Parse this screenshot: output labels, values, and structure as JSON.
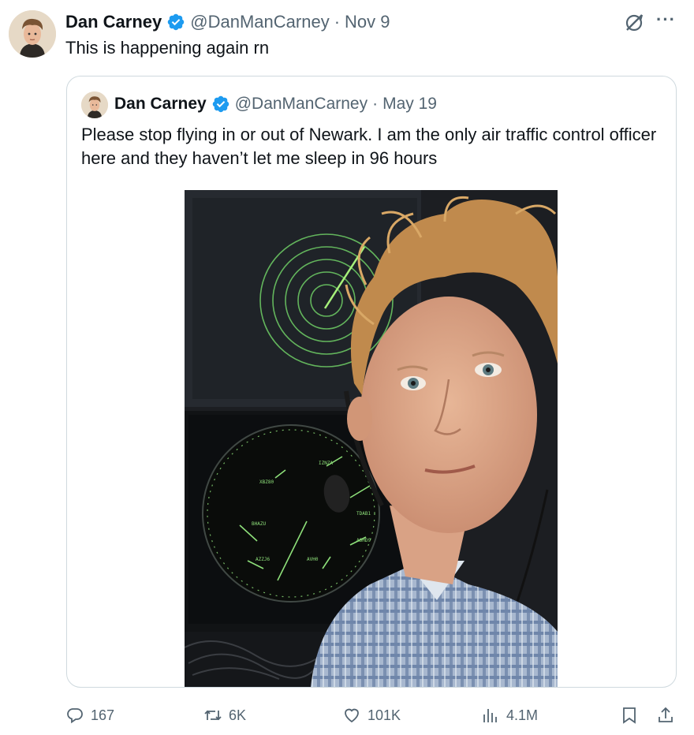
{
  "tweet": {
    "author_name": "Dan Carney",
    "handle": "@DanManCarney",
    "separator": "·",
    "date": "Nov 9",
    "text": "This is happening again rn",
    "more_label": "···"
  },
  "quoted": {
    "author_name": "Dan Carney",
    "handle": "@DanManCarney",
    "separator": "·",
    "date": "May 19",
    "text": "Please stop flying in or out of Newark. I am the only air traffic control officer here and they haven’t let me sleep in 96 hours"
  },
  "radar_labels": [
    "XBZ80",
    "IZNZA",
    "BHAZU",
    "TDAB1",
    "AVH0",
    "ASHD9",
    "AZZJ6"
  ],
  "actions": {
    "replies": "167",
    "reposts": "6K",
    "likes": "101K",
    "views": "4.1M"
  },
  "colors": {
    "verified": "#1d9bf0",
    "secondary_text": "#536471",
    "border": "#cfd9de",
    "radar_green": "#8ee07a"
  }
}
